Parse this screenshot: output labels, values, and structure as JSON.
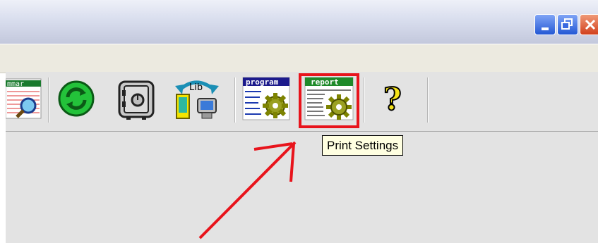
{
  "window": {
    "controls": [
      {
        "name": "minimize",
        "icon": "minimize-icon"
      },
      {
        "name": "restore",
        "icon": "restore-icon"
      },
      {
        "name": "close",
        "icon": "close-icon"
      }
    ]
  },
  "toolbar": {
    "buttons": [
      {
        "id": "summary",
        "icon": "summary-magnifier-icon",
        "label": "mmar"
      },
      {
        "id": "refresh",
        "icon": "green-refresh-icon"
      },
      {
        "id": "safe",
        "icon": "safe-vault-icon"
      },
      {
        "id": "library",
        "icon": "library-sync-icon",
        "label": "Lib"
      },
      {
        "id": "program",
        "icon": "program-settings-icon",
        "label": "program"
      },
      {
        "id": "print_settings",
        "icon": "report-settings-icon",
        "label": "report"
      },
      {
        "id": "help",
        "icon": "help-question-icon",
        "label": "?"
      }
    ]
  },
  "tooltip": {
    "text": "Print Settings"
  },
  "annotation": {
    "highlight_color": "#e8141c",
    "arrow_color": "#e8141c"
  }
}
